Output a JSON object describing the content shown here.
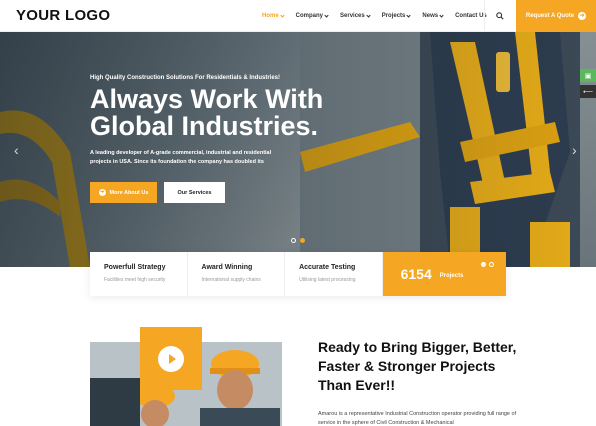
{
  "header": {
    "logo": "YOUR LOGO",
    "nav": [
      {
        "label": "Home",
        "dropdown": true,
        "active": true
      },
      {
        "label": "Company",
        "dropdown": true
      },
      {
        "label": "Services",
        "dropdown": true
      },
      {
        "label": "Projects",
        "dropdown": true
      },
      {
        "label": "News",
        "dropdown": true
      },
      {
        "label": "Contact Us",
        "dropdown": false
      }
    ],
    "quote_label": "Request A Quote"
  },
  "hero": {
    "subtitle": "High Quality Construction Solutions For Residentials & Industries!",
    "title": "Always Work With Global Industries.",
    "description": "A leading developer of A-grade commercial, industrial and residential projects in USA. Since its foundation the company has doubled its",
    "btn_more": "More About Us",
    "btn_services": "Our Services"
  },
  "features": [
    {
      "title": "Powerfull Strategy",
      "sub": "Facilities meet high security"
    },
    {
      "title": "Award Winning",
      "sub": "International supply chains"
    },
    {
      "title": "Accurate Testing",
      "sub": "Utilising latest processing"
    }
  ],
  "projects": {
    "count": "6154",
    "label": "Projects"
  },
  "about": {
    "title": "Ready to Bring Bigger, Better, Faster & Stronger Projects Than Ever!!",
    "text": "Amarou is a representative Industrial Construction operator providing full range of service in the sphere of Civil Construction & Mechanical"
  },
  "colors": {
    "accent": "#f5a623",
    "side_green": "#5cb85c"
  }
}
